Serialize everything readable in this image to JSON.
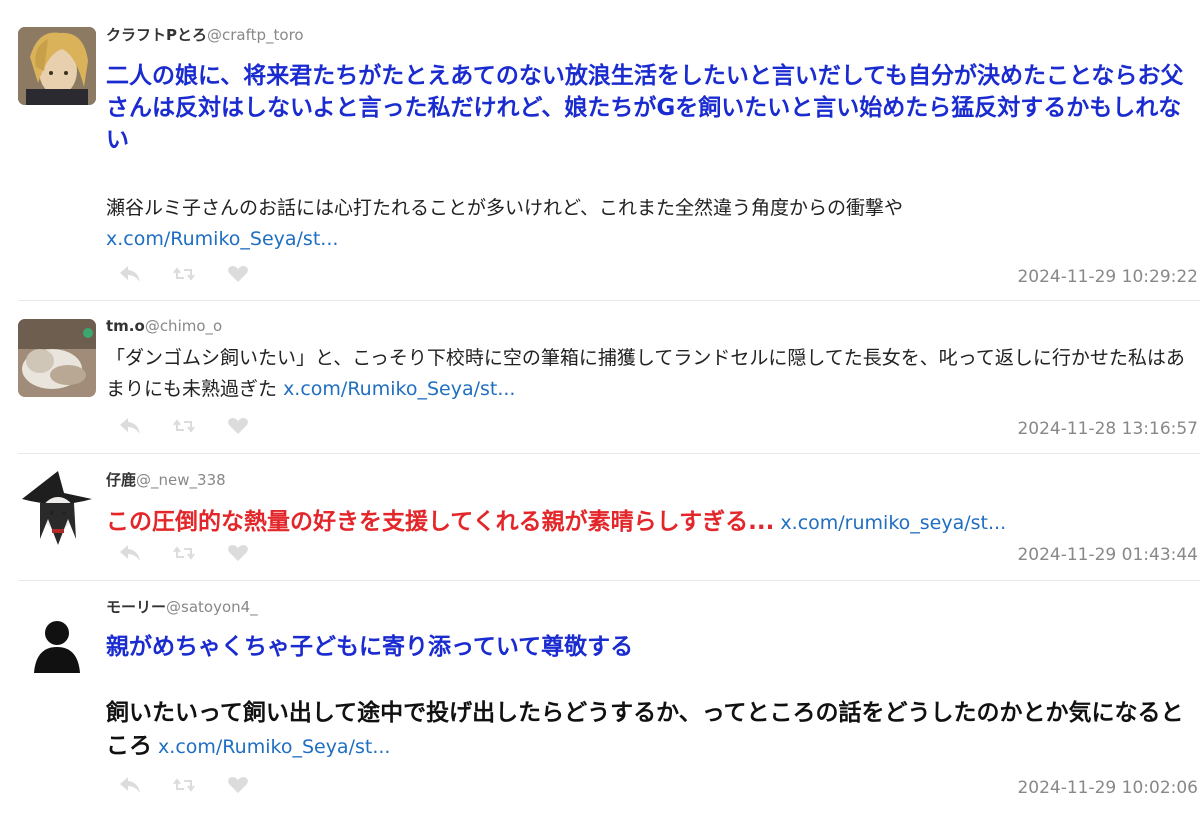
{
  "colors": {
    "blue_text": "#1a2bd0",
    "red_text": "#e3262a",
    "link": "#1f6ec1",
    "meta_gray": "#888888"
  },
  "tweets": [
    {
      "name": "クラフトPとろ",
      "handle": "@craftp_toro",
      "highlight": "二人の娘に、将来君たちがたとえあてのない放浪生活をしたいと言いだしても自分が決めたことならお父さんは反対はしないよと言った私だけれど、娘たちがGを飼いたいと言い始めたら猛反対するかもしれない",
      "body": "瀬谷ルミ子さんのお話には心打たれることが多いけれど、これまた全然違う角度からの衝撃や",
      "link": "x.com/Rumiko_Seya/st...",
      "timestamp": "2024-11-29 10:29:22"
    },
    {
      "name": "tm.o",
      "handle": "@chimo_o",
      "body": "「ダンゴムシ飼いたい」と、こっそり下校時に空の筆箱に捕獲してランドセルに隠してた長女を、叱って返しに行かせた私はあまりにも未熟過ぎた",
      "link": "x.com/Rumiko_Seya/st...",
      "timestamp": "2024-11-28 13:16:57"
    },
    {
      "name": "仔鹿",
      "handle": "@_new_338",
      "highlight": "この圧倒的な熱量の好きを支援してくれる親が素晴らしすぎる...",
      "link": "x.com/rumiko_seya/st...",
      "timestamp": "2024-11-29 01:43:44"
    },
    {
      "name": "モーリー",
      "handle": "@satoyon4_",
      "highlight": "親がめちゃくちゃ子どもに寄り添っていて尊敬する",
      "body": "飼いたいって飼い出して途中で投げ出したらどうするか、ってところの話をどうしたのかとか気になるところ",
      "link": "x.com/Rumiko_Seya/st...",
      "timestamp": "2024-11-29 10:02:06"
    }
  ],
  "icons": [
    "reply-icon",
    "retweet-icon",
    "like-icon",
    "default-avatar-icon"
  ]
}
